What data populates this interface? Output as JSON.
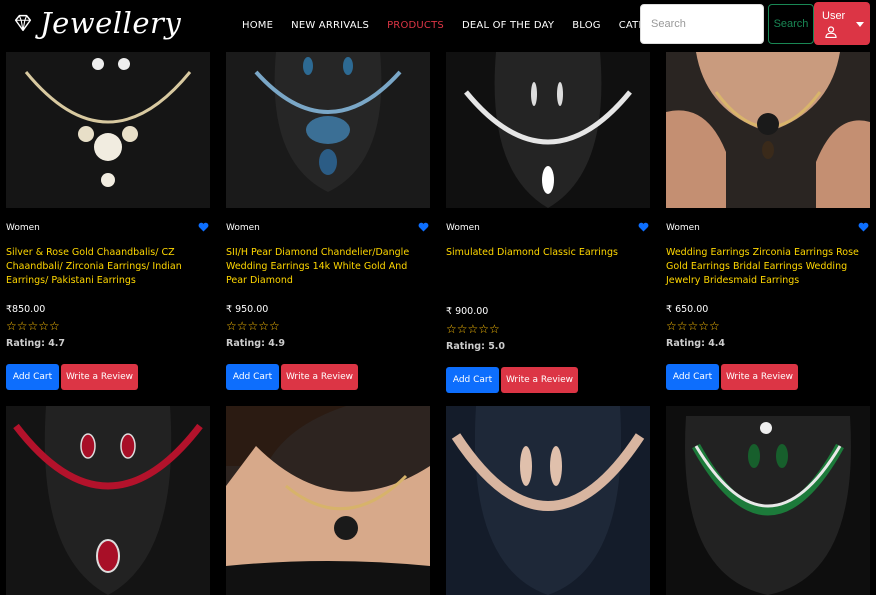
{
  "brand": {
    "name": "Jewellery",
    "logo_icon": "diamond-icon"
  },
  "nav": {
    "links": [
      "HOME",
      "NEW ARRIVALS",
      "PRODUCTS",
      "DEAL OF THE DAY",
      "BLOG",
      "CATEGORY"
    ],
    "active": "PRODUCTS"
  },
  "search": {
    "placeholder": "Search",
    "button_label": "Search"
  },
  "user": {
    "label": "User",
    "icon": "user-icon"
  },
  "colors": {
    "accent_red": "#dc3545",
    "blue": "#0d6efd",
    "title_yellow": "#ffd700",
    "star": "#ffc107",
    "search_green": "#198754"
  },
  "products": [
    {
      "category": "Women",
      "title": "Silver & Rose Gold Chaandbalis/ CZ Chaandbali/ Zirconia Earrings/ Indian Earrings/ Pakistani Earrings",
      "price": "₹850.00",
      "rating_label": "Rating: 4.7",
      "cart_label": "Add Cart",
      "review_label": "Write a Review"
    },
    {
      "category": "Women",
      "title": "SII/H Pear Diamond Chandelier/Dangle Wedding Earrings 14k White Gold And Pear Diamond",
      "price": "₹ 950.00",
      "rating_label": "Rating: 4.9",
      "cart_label": "Add Cart",
      "review_label": "Write a Review"
    },
    {
      "category": "Women",
      "title": "Simulated Diamond Classic Earrings",
      "price": "₹ 900.00",
      "rating_label": "Rating: 5.0",
      "cart_label": "Add Cart",
      "review_label": "Write a Review"
    },
    {
      "category": "Women",
      "title": "Wedding Earrings Zirconia Earrings Rose Gold Earrings Bridal Earrings Wedding Jewelry Bridesmaid Earrings",
      "price": "₹ 650.00",
      "rating_label": "Rating: 4.4",
      "cart_label": "Add Cart",
      "review_label": "Write a Review"
    }
  ],
  "stars_text": "☆☆☆☆☆"
}
